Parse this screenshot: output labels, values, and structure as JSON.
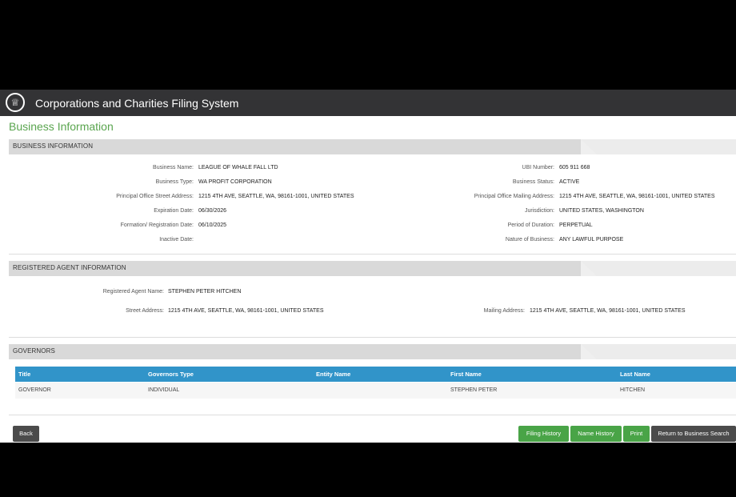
{
  "header": {
    "app_title": "Corporations and Charities Filing System",
    "seal_icon": "state-seal-icon"
  },
  "page_title": "Business Information",
  "business_info": {
    "section_label": "BUSINESS INFORMATION",
    "left": [
      {
        "label": "Business Name:",
        "value": "LEAGUE OF WHALE FALL LTD"
      },
      {
        "label": "Business Type:",
        "value": "WA PROFIT CORPORATION"
      },
      {
        "label": "Principal Office Street Address:",
        "value": "1215 4TH AVE, SEATTLE, WA, 98161-1001, UNITED STATES"
      },
      {
        "label": "Expiration Date:",
        "value": "06/30/2026"
      },
      {
        "label": "Formation/ Registration Date:",
        "value": "06/10/2025"
      },
      {
        "label": "Inactive Date:",
        "value": ""
      }
    ],
    "right": [
      {
        "label": "UBI Number:",
        "value": "605 911 668"
      },
      {
        "label": "Business Status:",
        "value": "ACTIVE"
      },
      {
        "label": "Principal Office Mailing Address:",
        "value": "1215 4TH AVE, SEATTLE, WA, 98161-1001, UNITED STATES"
      },
      {
        "label": "Jurisdiction:",
        "value": "UNITED STATES, WASHINGTON"
      },
      {
        "label": "Period of Duration:",
        "value": "PERPETUAL"
      },
      {
        "label": "Nature of Business:",
        "value": "ANY LAWFUL PURPOSE"
      }
    ]
  },
  "registered_agent": {
    "section_label": "REGISTERED AGENT INFORMATION",
    "name_label": "Registered Agent Name:",
    "name_value": "STEPHEN PETER HITCHEN",
    "street_label": "Street Address:",
    "street_value": "1215 4TH AVE, SEATTLE, WA, 98161-1001, UNITED STATES",
    "mailing_label": "Mailing Address:",
    "mailing_value": "1215 4TH AVE, SEATTLE, WA, 98161-1001, UNITED STATES"
  },
  "governors": {
    "section_label": "GOVERNORS",
    "columns": [
      "Title",
      "Governors Type",
      "Entity Name",
      "First Name",
      "Last Name"
    ],
    "rows": [
      [
        "GOVERNOR",
        "INDIVIDUAL",
        "",
        "STEPHEN PETER",
        "HITCHEN"
      ]
    ]
  },
  "buttons": {
    "back": "Back",
    "filing_history": "Filing History",
    "name_history": "Name History",
    "print": "Print",
    "return_search": "Return to Business Search"
  }
}
